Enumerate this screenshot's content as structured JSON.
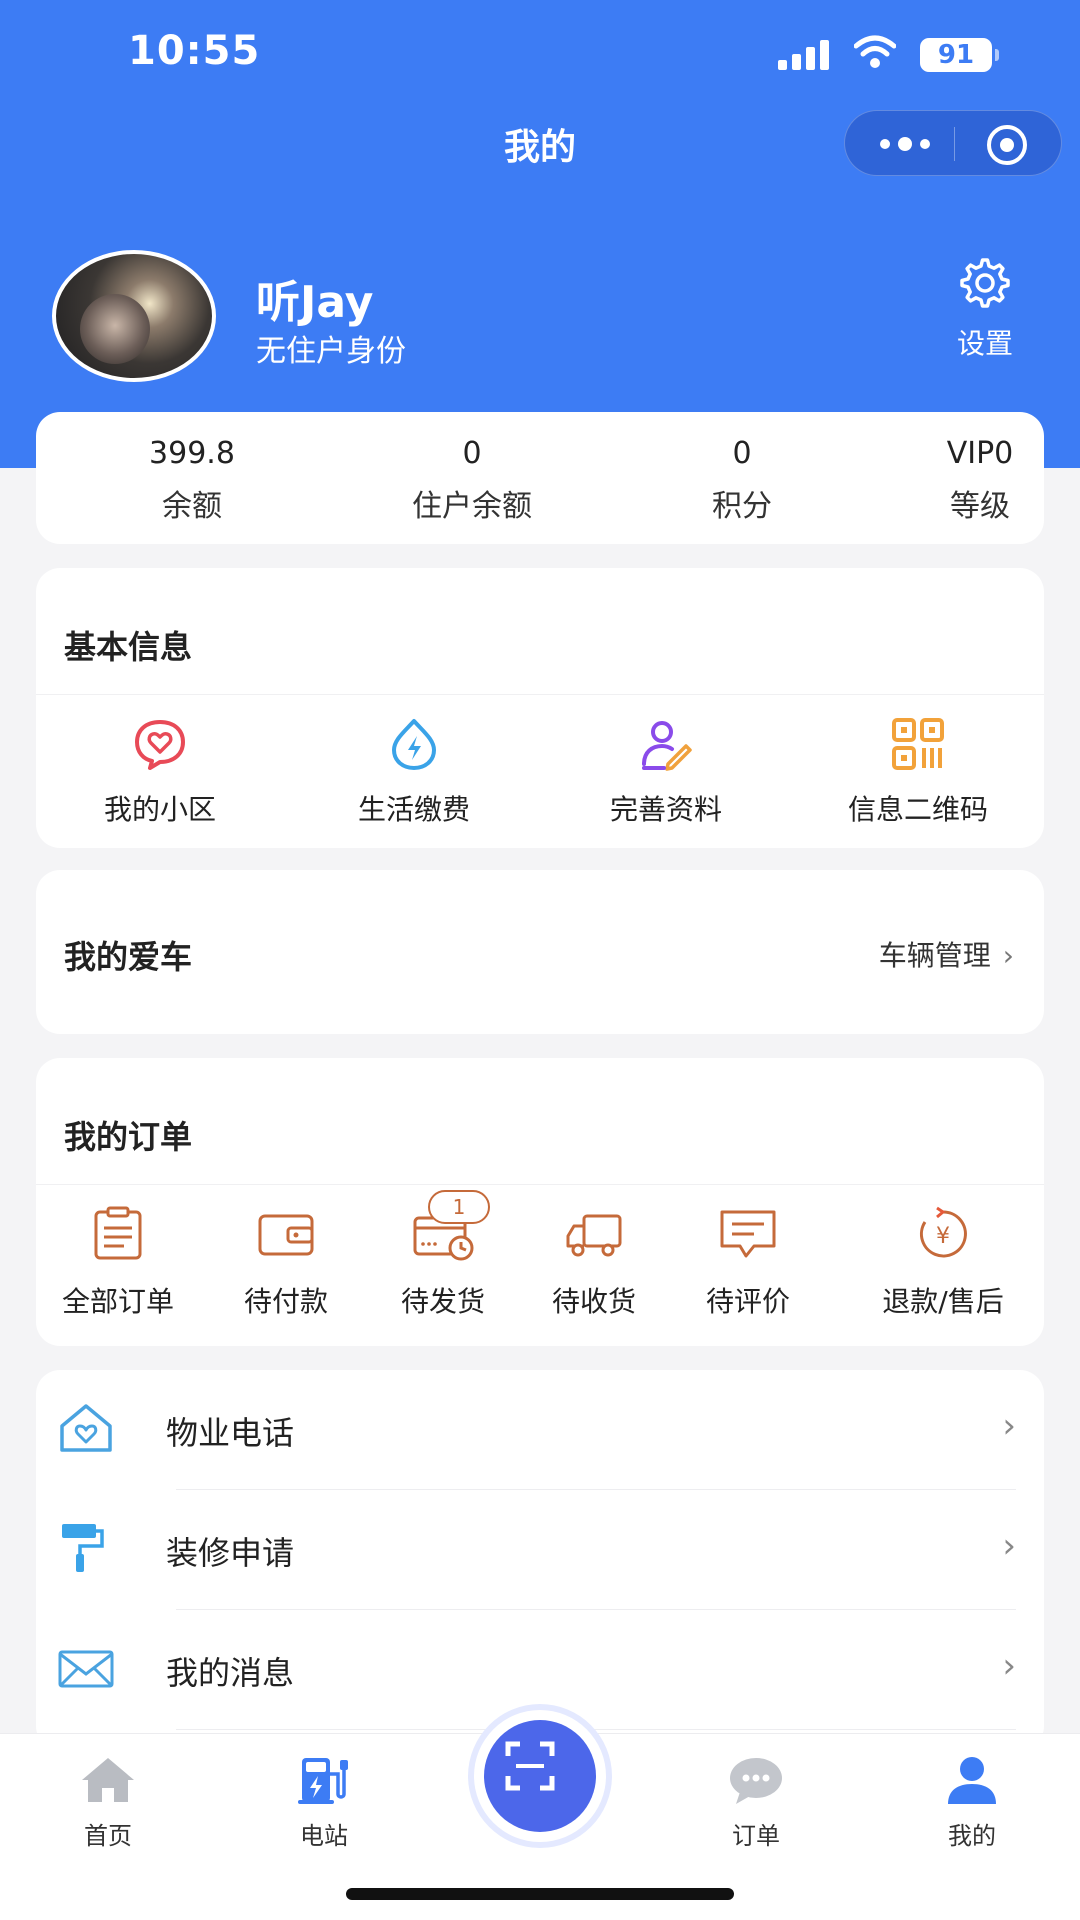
{
  "status_bar": {
    "time": "10:55",
    "battery": "91"
  },
  "nav": {
    "title": "我的"
  },
  "profile": {
    "name": "听Jay",
    "subtitle": "无住户身份",
    "settings_label": "设置"
  },
  "stats": [
    {
      "value": "399.8",
      "label": "余额"
    },
    {
      "value": "0",
      "label": "住户余额"
    },
    {
      "value": "0",
      "label": "积分"
    },
    {
      "value": "VIP0",
      "label": "等级"
    }
  ],
  "basic_info": {
    "title": "基本信息",
    "items": [
      {
        "label": "我的小区",
        "icon": "heart-chat-icon",
        "color": "#e84a57"
      },
      {
        "label": "生活缴费",
        "icon": "lightning-drop-icon",
        "color": "#3aa3e8"
      },
      {
        "label": "完善资料",
        "icon": "edit-profile-icon",
        "color": "#8a4bea"
      },
      {
        "label": "信息二维码",
        "icon": "qr-code-icon",
        "color": "#f2a23a"
      }
    ]
  },
  "car": {
    "title": "我的爱车",
    "manage_label": "车辆管理",
    "chevron": "›"
  },
  "orders": {
    "title": "我的订单",
    "items": [
      {
        "label": "全部订单",
        "icon": "clipboard-icon"
      },
      {
        "label": "待付款",
        "icon": "wallet-icon"
      },
      {
        "label": "待发货",
        "icon": "card-clock-icon",
        "badge": "1"
      },
      {
        "label": "待收货",
        "icon": "truck-icon"
      },
      {
        "label": "待评价",
        "icon": "comment-icon"
      },
      {
        "label": "退款/售后",
        "icon": "refund-icon"
      }
    ]
  },
  "menu": [
    {
      "label": "物业电话",
      "icon": "house-heart-icon",
      "chevron": "›"
    },
    {
      "label": "装修申请",
      "icon": "paint-roller-icon",
      "chevron": "›"
    },
    {
      "label": "我的消息",
      "icon": "envelope-icon",
      "chevron": "›"
    }
  ],
  "tabbar": {
    "items": [
      {
        "label": "首页",
        "icon": "home-icon"
      },
      {
        "label": "电站",
        "icon": "charging-station-icon"
      },
      {
        "label": "订单",
        "icon": "chat-bubble-icon"
      },
      {
        "label": "我的",
        "icon": "person-icon",
        "active": true
      }
    ],
    "center_icon": "scan-icon"
  },
  "colors": {
    "primary": "#3d7cf4",
    "order_icon": "#c56a3a",
    "scan_button": "#4c67ea"
  }
}
